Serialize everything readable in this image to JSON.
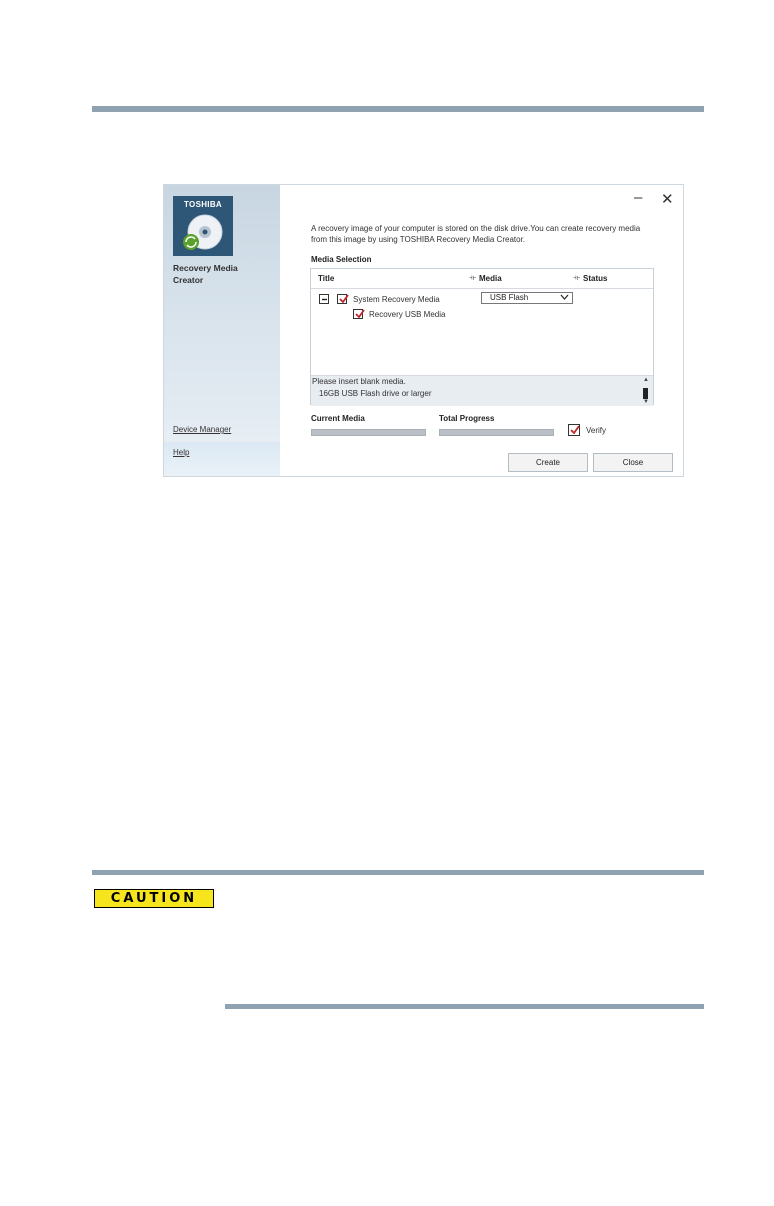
{
  "app": {
    "brand": "TOSHIBA",
    "name_line1": "Recovery Media",
    "name_line2": "Creator"
  },
  "window_controls": {
    "minimize": "–",
    "close": "✕"
  },
  "sidebar": {
    "links": [
      {
        "label": "Device Manager"
      },
      {
        "label": "Help"
      }
    ]
  },
  "main": {
    "description_line1": "A recovery image of your computer is stored on the disk drive.You can create recovery media",
    "description_line2": "from this image by using TOSHIBA Recovery Media Creator.",
    "section_label": "Media Selection",
    "columns": [
      "Title",
      "Media",
      "Status"
    ],
    "rows": [
      {
        "label": "System Recovery Media",
        "checked": true
      },
      {
        "label": "Recovery USB Media",
        "checked": true
      }
    ],
    "media_select": {
      "selected": "USB Flash"
    },
    "info_line1": "Please insert blank media.",
    "info_line2": "16GB USB Flash drive or larger",
    "current_media_label": "Current Media",
    "total_progress_label": "Total Progress",
    "current_media_progress": 0,
    "total_progress": 0,
    "verify_label": "Verify",
    "verify_checked": true,
    "create_label": "Create",
    "close_label": "Close"
  },
  "page": {
    "caution_label": "CAUTION"
  },
  "colors": {
    "rule": "#8fa2b2",
    "caution_bg": "#f6e51c",
    "check_mark": "#c0282d",
    "logo_bg": "#2e5676"
  }
}
